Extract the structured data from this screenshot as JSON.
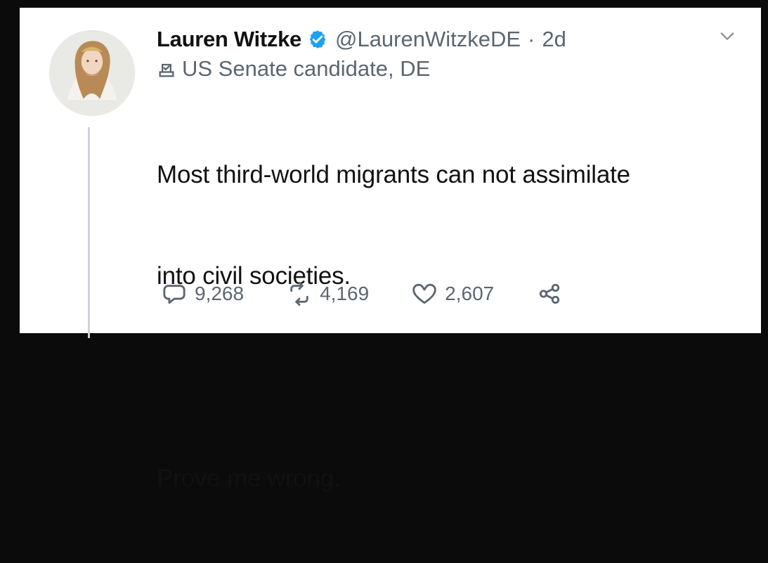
{
  "tweet": {
    "author_name": "Lauren Witzke",
    "handle": "@LaurenWitzkeDE",
    "separator": "·",
    "time": "2d",
    "label": "US Senate candidate, DE",
    "text_line1": "Most third-world migrants can not assimilate",
    "text_line2": "into civil societies.",
    "text_line3": "",
    "text_line4": "Prove me wrong.",
    "metrics": {
      "replies": "9,268",
      "retweets": "4,169",
      "likes": "2,607"
    }
  },
  "icons": {
    "verified": "verified-badge-icon",
    "label": "ballot-box-icon",
    "more": "chevron-down-icon",
    "reply": "reply-icon",
    "retweet": "retweet-icon",
    "like": "heart-icon",
    "share": "share-icon"
  },
  "colors": {
    "verified_blue": "#1DA1F2",
    "secondary_text": "#5b6670",
    "primary_text": "#111111"
  }
}
